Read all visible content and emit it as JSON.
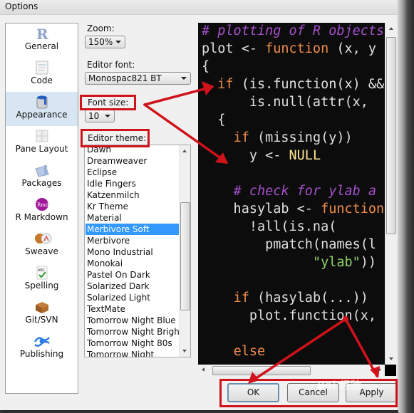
{
  "window": {
    "title": "Options"
  },
  "sidebar": {
    "items": [
      {
        "label": "General",
        "icon": "r-logo-icon",
        "selected": false
      },
      {
        "label": "Code",
        "icon": "code-document-icon",
        "selected": false
      },
      {
        "label": "Appearance",
        "icon": "paint-bucket-icon",
        "selected": true
      },
      {
        "label": "Pane Layout",
        "icon": "pane-grid-icon",
        "selected": false
      },
      {
        "label": "Packages",
        "icon": "package-box-icon",
        "selected": false
      },
      {
        "label": "R Markdown",
        "icon": "rmd-badge-icon",
        "selected": false
      },
      {
        "label": "Sweave",
        "icon": "sweave-pdf-icon",
        "selected": false
      },
      {
        "label": "Spelling",
        "icon": "abc-check-icon",
        "selected": false
      },
      {
        "label": "Git/SVN",
        "icon": "git-box-icon",
        "selected": false
      },
      {
        "label": "Publishing",
        "icon": "publishing-eye-icon",
        "selected": false
      }
    ]
  },
  "appearance": {
    "zoom_label": "Zoom:",
    "zoom_value": "150%",
    "editor_font_label": "Editor font:",
    "editor_font_value": "Monospac821 BT",
    "font_size_label": "Font size:",
    "font_size_value": "10",
    "editor_theme_label": "Editor theme:",
    "themes": [
      "Dawn",
      "Dreamweaver",
      "Eclipse",
      "Idle Fingers",
      "Katzenmilch",
      "Kr Theme",
      "Material",
      "Merbivore Soft",
      "Merbivore",
      "Mono Industrial",
      "Monokai",
      "Pastel On Dark",
      "Solarized Dark",
      "Solarized Light",
      "TextMate",
      "Tomorrow Night Blue",
      "Tomorrow Night Bright",
      "Tomorrow Night 80s",
      "Tomorrow Night"
    ],
    "selected_theme": "Merbivore Soft"
  },
  "preview": {
    "lines": [
      [
        {
          "t": "# plotting of R objects",
          "c": "cm"
        }
      ],
      [
        {
          "t": "plot <- ",
          "c": ""
        },
        {
          "t": "function",
          "c": "kw"
        },
        {
          "t": " (x, y",
          "c": ""
        }
      ],
      [
        {
          "t": "{",
          "c": ""
        }
      ],
      [
        {
          "t": "  ",
          "c": ""
        },
        {
          "t": "if",
          "c": "kw"
        },
        {
          "t": " (is.function(x) &&",
          "c": ""
        }
      ],
      [
        {
          "t": "      is.null(attr(x, ",
          "c": ""
        }
      ],
      [
        {
          "t": "  {",
          "c": ""
        }
      ],
      [
        {
          "t": "    ",
          "c": ""
        },
        {
          "t": "if",
          "c": "kw"
        },
        {
          "t": " (missing(y))",
          "c": ""
        }
      ],
      [
        {
          "t": "      y <- ",
          "c": ""
        },
        {
          "t": "NULL",
          "c": "nu"
        }
      ],
      [
        {
          "t": "",
          "c": ""
        }
      ],
      [
        {
          "t": "    ",
          "c": ""
        },
        {
          "t": "# check for ylab a",
          "c": "cm"
        }
      ],
      [
        {
          "t": "    hasylab <- ",
          "c": ""
        },
        {
          "t": "function",
          "c": "kw"
        }
      ],
      [
        {
          "t": "      !all(is.na(",
          "c": ""
        }
      ],
      [
        {
          "t": "        pmatch(names(l",
          "c": ""
        }
      ],
      [
        {
          "t": "              ",
          "c": ""
        },
        {
          "t": "\"ylab\"",
          "c": "st"
        },
        {
          "t": "))",
          "c": ""
        }
      ],
      [
        {
          "t": "",
          "c": ""
        }
      ],
      [
        {
          "t": "    ",
          "c": ""
        },
        {
          "t": "if",
          "c": "kw"
        },
        {
          "t": " (hasylab(...))",
          "c": ""
        }
      ],
      [
        {
          "t": "      plot.function(x,",
          "c": ""
        }
      ],
      [
        {
          "t": "",
          "c": ""
        }
      ],
      [
        {
          "t": "    ",
          "c": ""
        },
        {
          "t": "else",
          "c": "kw"
        }
      ]
    ]
  },
  "buttons": {
    "ok": "OK",
    "cancel": "Cancel",
    "apply": "Apply"
  },
  "annotation": {
    "color": "#d0121a",
    "watermark": "Bai 经验"
  }
}
